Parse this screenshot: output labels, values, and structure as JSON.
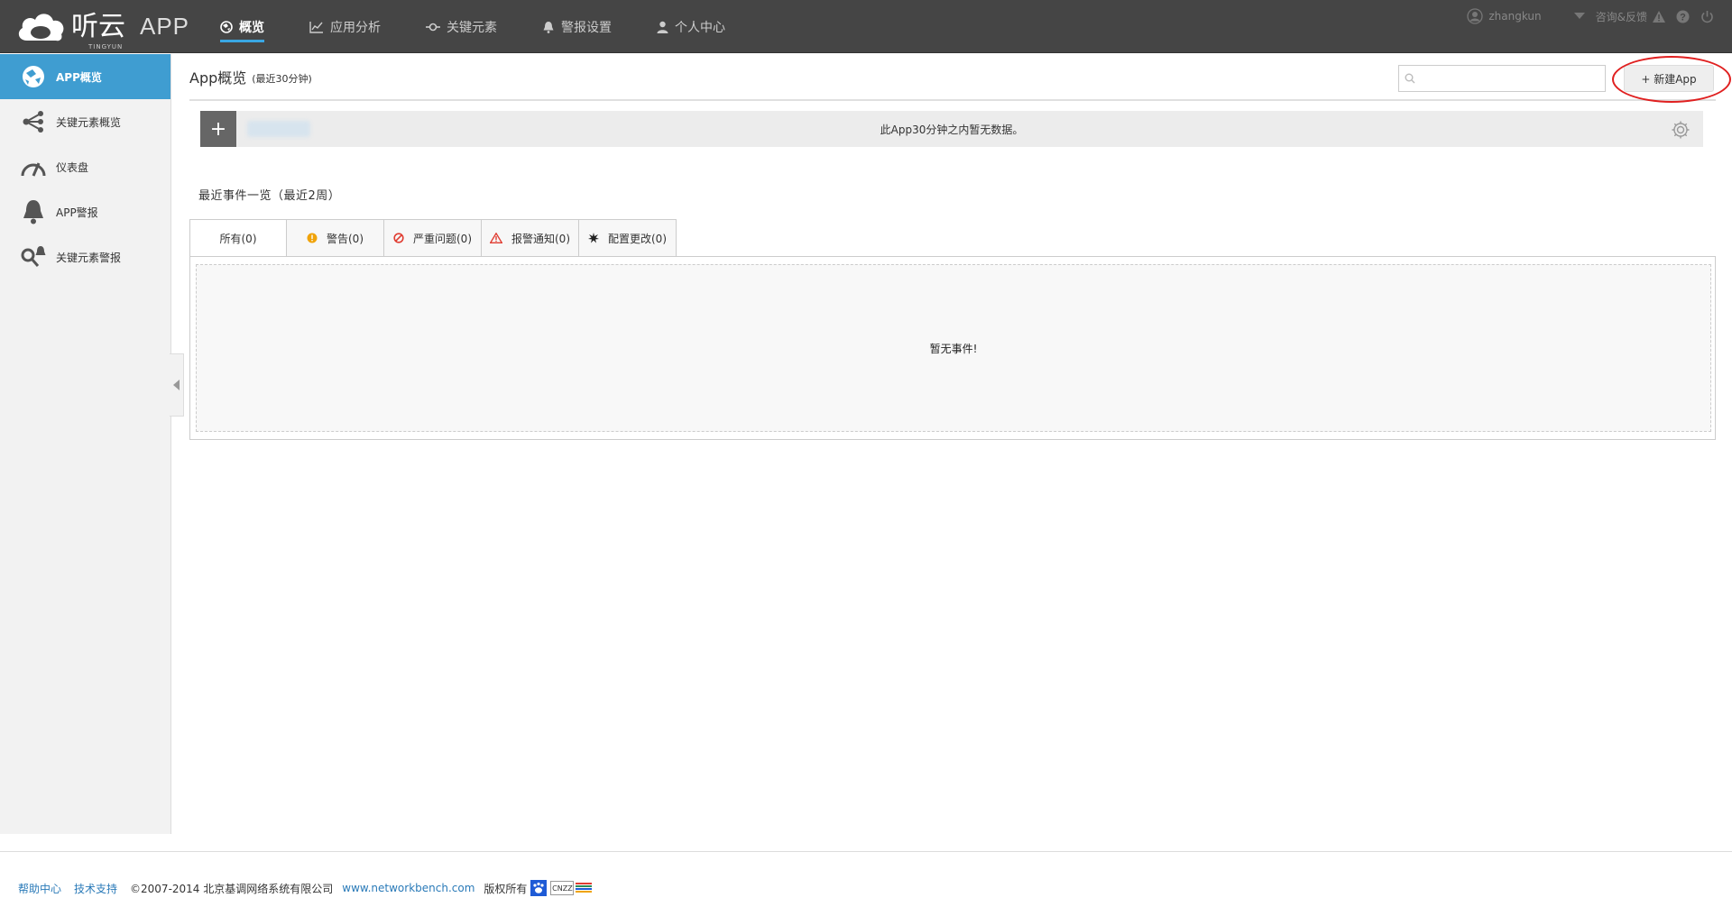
{
  "brand": {
    "logo_text": "听云",
    "logo_sub": "TINGYUN",
    "product": "APP"
  },
  "nav": {
    "items": [
      {
        "label": "概览",
        "icon": "globe-icon",
        "active": true
      },
      {
        "label": "应用分析",
        "icon": "chart-icon",
        "active": false
      },
      {
        "label": "关键元素",
        "icon": "node-icon",
        "active": false
      },
      {
        "label": "警报设置",
        "icon": "bell-icon",
        "active": false
      },
      {
        "label": "个人中心",
        "icon": "user-icon",
        "active": false
      }
    ]
  },
  "user": {
    "name": "zhangkun",
    "feedback": "咨询&反馈"
  },
  "sidebar": {
    "items": [
      {
        "label": "APP概览",
        "icon": "globe-icon",
        "active": true
      },
      {
        "label": "关键元素概览",
        "icon": "share-nodes-icon",
        "active": false
      },
      {
        "label": "仪表盘",
        "icon": "gauge-icon",
        "active": false
      },
      {
        "label": "APP警报",
        "icon": "bell-icon",
        "active": false
      },
      {
        "label": "关键元素警报",
        "icon": "key-bell-icon",
        "active": false
      }
    ]
  },
  "main": {
    "title": "App概览",
    "subtitle": "(最近30分钟)",
    "search_placeholder": "",
    "new_app_label": "+ 新建App",
    "app_row": {
      "add_label": "+",
      "message": "此App30分钟之内暂无数据。"
    },
    "events_title": "最近事件一览（最近2周）",
    "tabs": [
      {
        "label": "所有(0)",
        "icon": ""
      },
      {
        "label": "警告(0)",
        "icon": "warning-dot-icon"
      },
      {
        "label": "严重问题(0)",
        "icon": "prohibit-icon"
      },
      {
        "label": "报警通知(0)",
        "icon": "alert-triangle-icon"
      },
      {
        "label": "配置更改(0)",
        "icon": "burst-icon"
      }
    ],
    "empty_text": "暂无事件!"
  },
  "footer": {
    "help": "帮助中心",
    "support": "技术支持",
    "copyright": "©2007-2014  北京基调网络系统有限公司",
    "site": "www.networkbench.com",
    "rights": "版权所有",
    "cnzz": "CNZZ"
  },
  "colors": {
    "topbar": "#454545",
    "accent": "#3f9dd1",
    "ring": "#e02020"
  }
}
